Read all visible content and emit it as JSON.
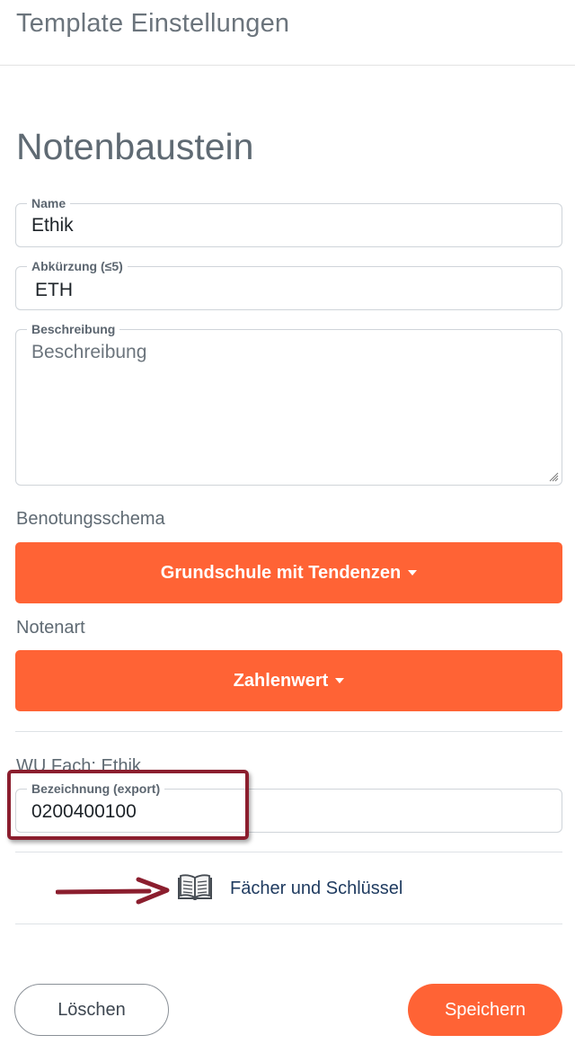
{
  "header": {
    "title": "Template Einstellungen"
  },
  "section": {
    "title": "Notenbaustein"
  },
  "fields": {
    "name": {
      "label": "Name",
      "value": "Ethik"
    },
    "abbreviation": {
      "label": "Abkürzung (≤5)",
      "value": "ETH"
    },
    "description": {
      "label": "Beschreibung",
      "placeholder": "Beschreibung"
    },
    "export_name": {
      "label": "Bezeichnung (export)",
      "value": "0200400100"
    }
  },
  "grading_scheme": {
    "label": "Benotungsschema",
    "selected": "Grundschule mit Tendenzen"
  },
  "grade_type": {
    "label": "Notenart",
    "selected": "Zahlenwert"
  },
  "wu_subject": {
    "label": "WU Fach: Ethik"
  },
  "subjects_link": {
    "label": "Fächer und Schlüssel"
  },
  "actions": {
    "delete_label": "Löschen",
    "save_label": "Speichern"
  },
  "colors": {
    "accent": "#ff6335",
    "annotation": "#8b1e2e"
  }
}
